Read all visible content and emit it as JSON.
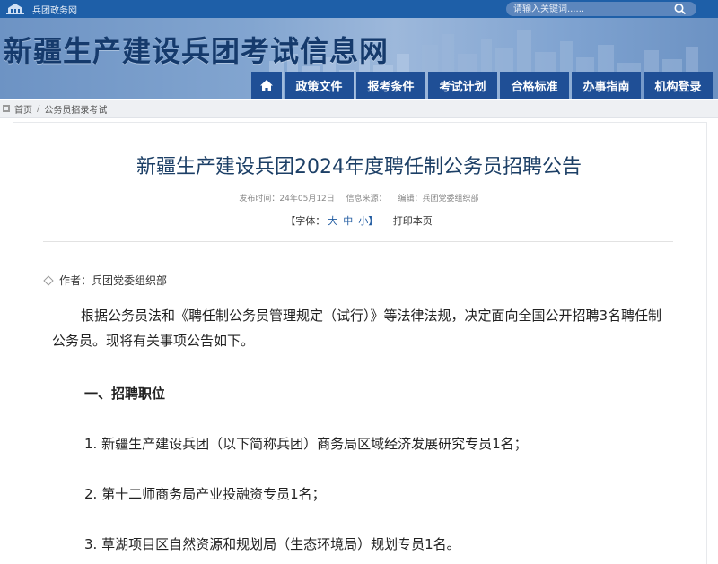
{
  "top": {
    "home_link": "兵团政务网",
    "search_placeholder": "请输入关键词......"
  },
  "header": {
    "site_title": "新疆生产建设兵团考试信息网"
  },
  "nav": {
    "items": [
      "政策文件",
      "报考条件",
      "考试计划",
      "合格标准",
      "办事指南",
      "机构登录"
    ]
  },
  "breadcrumb": {
    "home": "首页",
    "separator": "/",
    "current": "公务员招录考试"
  },
  "article": {
    "title": "新疆生产建设兵团2024年度聘任制公务员招聘公告",
    "publish_time": "发布时间：24年05月12日",
    "source": "信息来源：",
    "editor": "编辑：兵团党委组织部",
    "font_label_open": "【字体：",
    "font_large": "大",
    "font_medium": "中",
    "font_small": "小】",
    "print": "打印本页",
    "author": "作者：兵团党委组织部",
    "paragraph1": "根据公务员法和《聘任制公务员管理规定（试行）》等法律法规，决定面向全国公开招聘3名聘任制公务员。现将有关事项公告如下。",
    "section1_title": "一、招聘职位",
    "items": [
      "1. 新疆生产建设兵团（以下简称兵团）商务局区域经济发展研究专员1名；",
      "2. 第十二师商务局产业投融资专员1名；",
      "3. 草湖项目区自然资源和规划局（生态环境局）规划专员1名。"
    ]
  },
  "colors": {
    "top_bar": "#1e5fa8",
    "nav_bg": "#1f4f96",
    "title": "#1c3f66",
    "link": "#1f5aa0"
  }
}
